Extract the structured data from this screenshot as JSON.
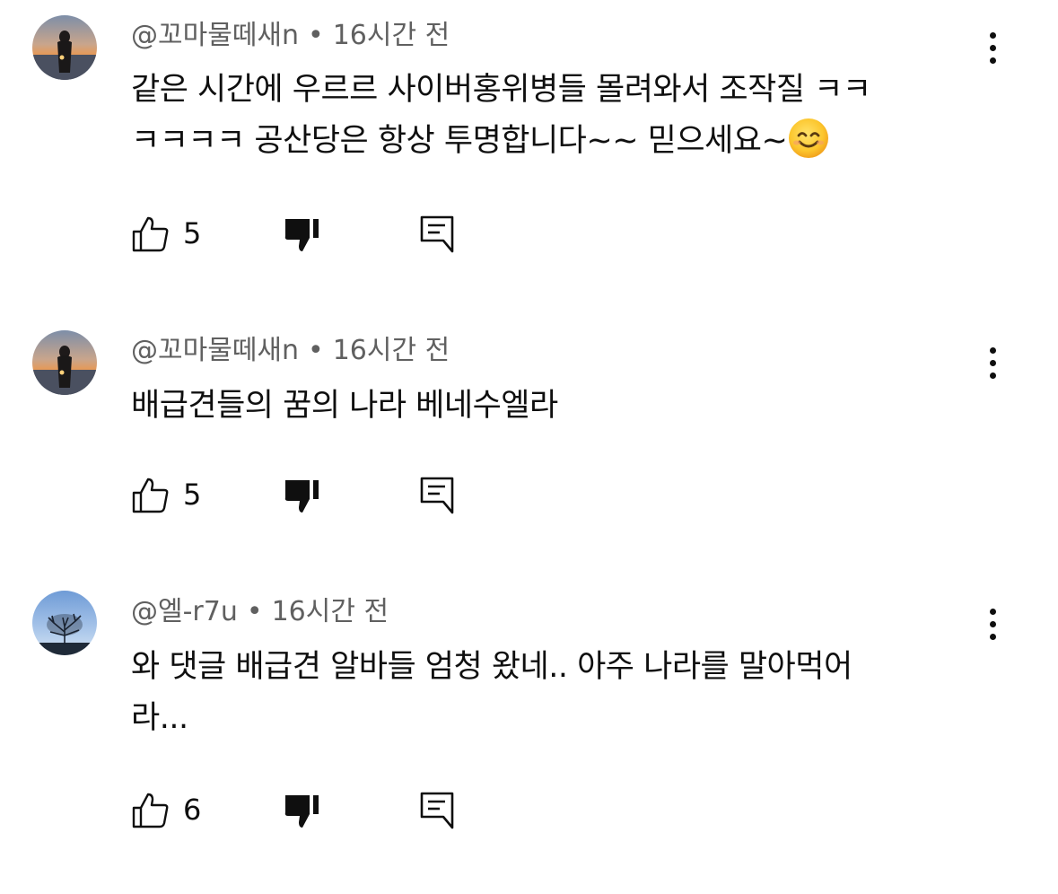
{
  "comments": [
    {
      "author": "@꼬마물떼새n",
      "separator": "•",
      "time": "16시간 전",
      "text_line1": "같은 시간에 우르르 사이버홍위병들 몰려와서 조작질 ㅋㅋ",
      "text_line2": "ㅋㅋㅋㅋ 공산당은 항상 투명합니다~~ 믿으세요~",
      "emoji": "smiling-face-icon",
      "likes": "5",
      "avatar": "woman-sunset-avatar"
    },
    {
      "author": "@꼬마물떼새n",
      "separator": "•",
      "time": "16시간 전",
      "text_line1": "배급견들의 꿈의 나라 베네수엘라",
      "likes": "5",
      "avatar": "woman-sunset-avatar"
    },
    {
      "author": "@엘-r7u",
      "separator": "•",
      "time": "16시간 전",
      "text_line1": "와 댓글 배급견 알바들 엄청 왔네.. 아주 나라를 말아먹어",
      "text_line2": "라...",
      "likes": "6",
      "avatar": "tree-sky-avatar"
    }
  ],
  "colors": {
    "text": "#0f0f0f",
    "meta": "#606060",
    "background": "#ffffff"
  }
}
